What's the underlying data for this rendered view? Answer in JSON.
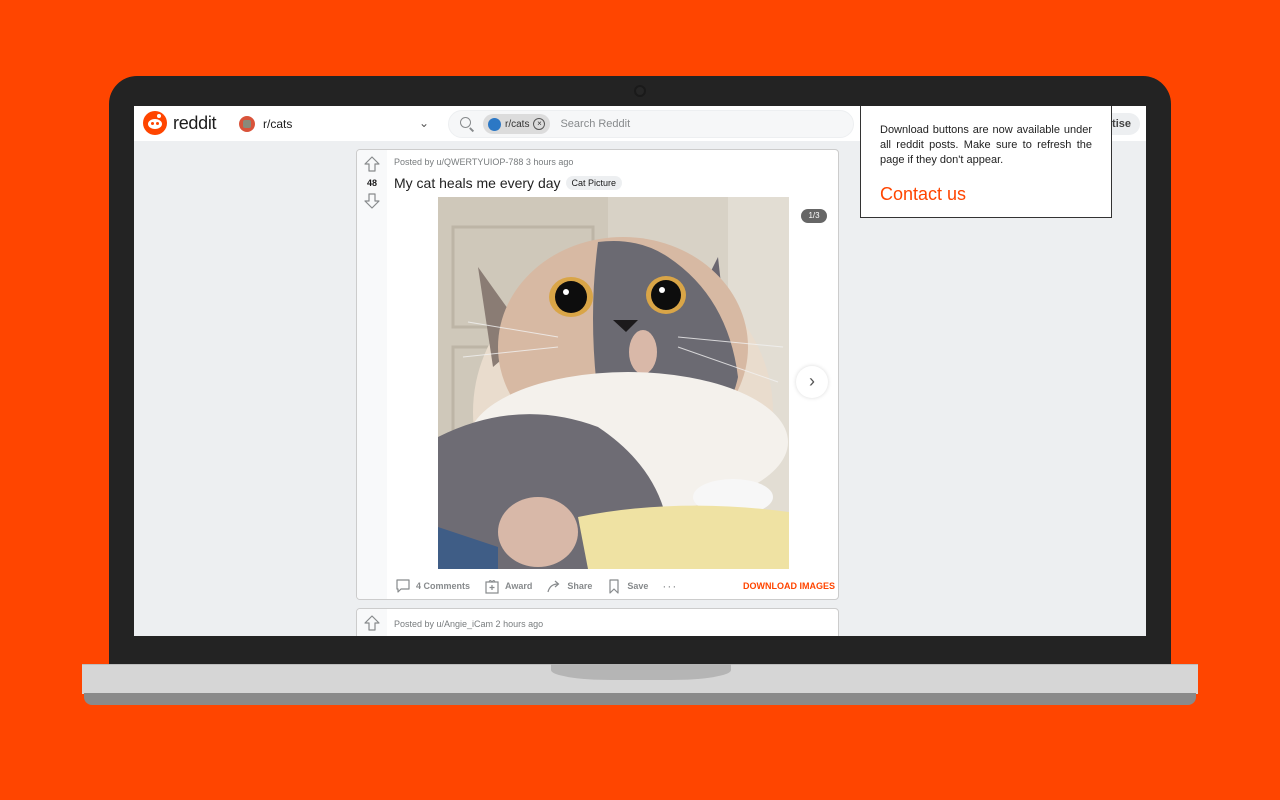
{
  "app": {
    "brand": "reddit",
    "subreddit": "r/cats"
  },
  "search": {
    "chip_label": "r/cats",
    "placeholder": "Search Reddit"
  },
  "header": {
    "advertise_label": "Advertise",
    "advertise_visible": "tise"
  },
  "popup": {
    "message": "Download buttons are now available under all reddit posts. Make sure to refresh the page if they don't appear.",
    "link_label": "Contact us"
  },
  "posts": [
    {
      "meta": "Posted by u/QWERTYUIOP-788 3 hours ago",
      "votes": "48",
      "title": "My cat heals me every day",
      "flair": "Cat Picture",
      "gallery_counter": "1/3",
      "actions": {
        "comments": "4 Comments",
        "award": "Award",
        "share": "Share",
        "save": "Save",
        "more": "···",
        "download": "DOWNLOAD IMAGES"
      }
    },
    {
      "meta": "Posted by u/Angie_iCam 2 hours ago"
    }
  ],
  "colors": {
    "background": "#ff4500",
    "accent": "#ff4500",
    "bezel": "#232323"
  }
}
